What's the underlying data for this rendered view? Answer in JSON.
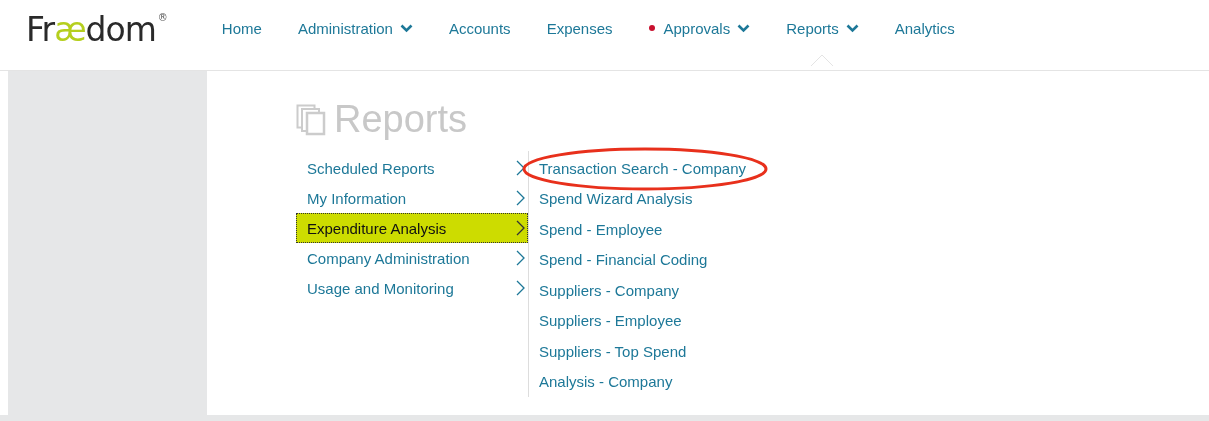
{
  "logo": {
    "parts": [
      {
        "text": "Fr",
        "accent": false
      },
      {
        "text": "æ",
        "accent": true
      },
      {
        "text": "dom",
        "accent": false
      }
    ],
    "mark": "®"
  },
  "nav": [
    {
      "label": "Home",
      "dropdown": false,
      "alert": false,
      "selected": false
    },
    {
      "label": "Administration",
      "dropdown": true,
      "alert": false,
      "selected": false
    },
    {
      "label": "Accounts",
      "dropdown": false,
      "alert": false,
      "selected": false
    },
    {
      "label": "Expenses",
      "dropdown": false,
      "alert": false,
      "selected": false
    },
    {
      "label": "Approvals",
      "dropdown": true,
      "alert": true,
      "selected": false
    },
    {
      "label": "Reports",
      "dropdown": true,
      "alert": false,
      "selected": true
    },
    {
      "label": "Analytics",
      "dropdown": false,
      "alert": false,
      "selected": false
    }
  ],
  "page_title": "Reports",
  "categories": [
    {
      "label": "Scheduled Reports",
      "selected": false
    },
    {
      "label": "My Information",
      "selected": false
    },
    {
      "label": "Expenditure Analysis",
      "selected": true
    },
    {
      "label": "Company Administration",
      "selected": false
    },
    {
      "label": "Usage and Monitoring",
      "selected": false
    }
  ],
  "reports": [
    {
      "label": "Transaction Search - Company",
      "circled": true
    },
    {
      "label": "Spend Wizard Analysis",
      "circled": false
    },
    {
      "label": "Spend - Employee",
      "circled": false
    },
    {
      "label": "Spend - Financial Coding",
      "circled": false
    },
    {
      "label": "Suppliers - Company",
      "circled": false
    },
    {
      "label": "Suppliers - Employee",
      "circled": false
    },
    {
      "label": "Suppliers - Top Spend",
      "circled": false
    },
    {
      "label": "Analysis - Company",
      "circled": false
    }
  ]
}
